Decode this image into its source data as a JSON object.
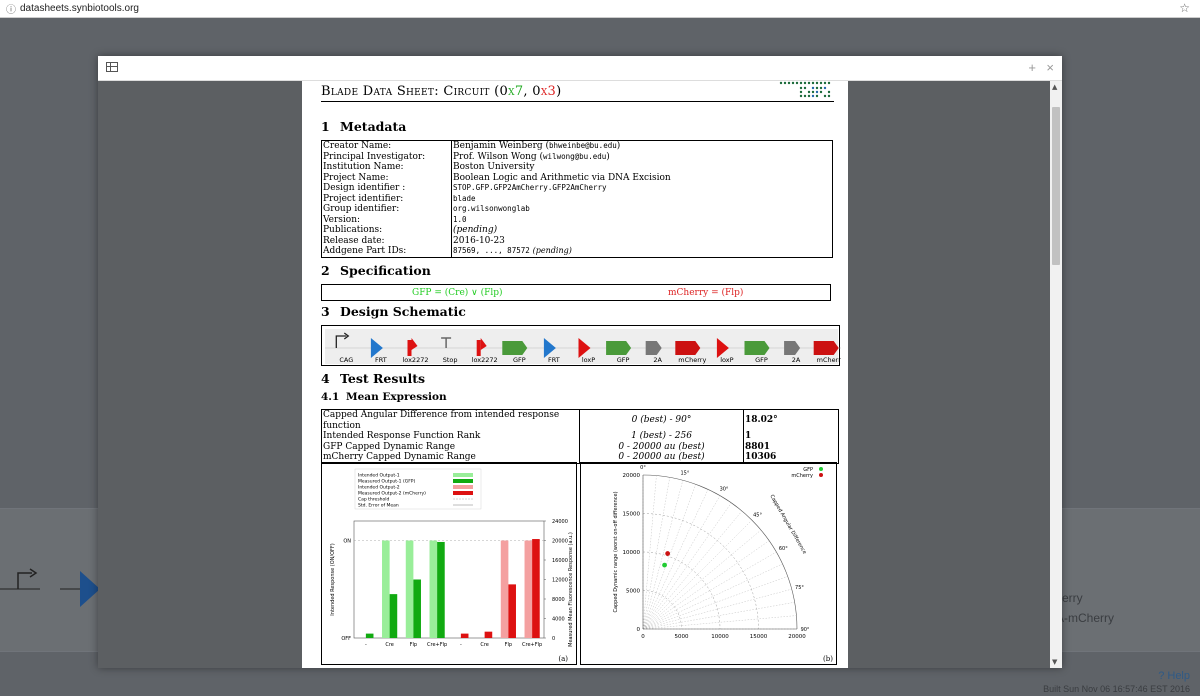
{
  "browser": {
    "url": "datasheets.synbiotools.org",
    "star": "☆"
  },
  "background": {
    "partial_text_1": "erry",
    "partial_text_2": "A-mCherry",
    "help": "Help",
    "footer": "Built Sun Nov 06 16:57:46 EST 2016"
  },
  "modal": {
    "icon": "table-icon",
    "plus": "+",
    "close": "×",
    "scroll_up": "▲",
    "scroll_down": "▼"
  },
  "doc": {
    "title_prefix": "Blade Data Sheet: Circuit (0",
    "title_x1": "x7",
    "title_mid": ", 0",
    "title_x2": "x3",
    "title_suffix": ")",
    "sections": {
      "s1": {
        "num": "1",
        "label": "Metadata"
      },
      "s2": {
        "num": "2",
        "label": "Specification"
      },
      "s3": {
        "num": "3",
        "label": "Design Schematic"
      },
      "s4": {
        "num": "4",
        "label": "Test Results"
      },
      "s41": {
        "num": "4.1",
        "label": "Mean Expression"
      }
    },
    "metadata": {
      "creator_k": "Creator Name:",
      "creator_v": "Benjamin Weinberg (",
      "creator_email": "bhweinbe@bu.edu",
      "creator_close": ")",
      "pi_k": "Principal Investigator:",
      "pi_v": "Prof. Wilson Wong (",
      "pi_email": "wilwong@bu.edu",
      "pi_close": ")",
      "inst_k": "Institution Name:",
      "inst_v": "Boston University",
      "proj_k": "Project Name:",
      "proj_v": "Boolean Logic and Arithmetic via DNA Excision",
      "design_k": "Design identifier :",
      "design_v": "STOP.GFP.GFP2AmCherry.GFP2AmCherry",
      "projid_k": "Project identifier:",
      "projid_v": "blade",
      "group_k": "Group identifier:",
      "group_v": "org.wilsonwonglab",
      "ver_k": "Version:",
      "ver_v": "1.0",
      "pub_k": "Publications:",
      "pub_v": "(pending)",
      "rel_k": "Release date:",
      "rel_v": "2016-10-23",
      "addgene_k": "Addgene Part IDs:",
      "addgene_v": "87569, ..., 87572",
      "addgene_note": "(pending)"
    },
    "spec": {
      "gfp": "GFP = (Cre) ∨ (Flp)",
      "mcherry": "mCherry = (Flp)"
    },
    "schematic": [
      "CAG",
      "FRT",
      "lox2272",
      "Stop",
      "lox2272",
      "GFP",
      "FRT",
      "loxP",
      "GFP",
      "2A",
      "mCherry",
      "loxP",
      "GFP",
      "2A",
      "mCherry"
    ],
    "results": [
      {
        "label": "Capped Angular Difference from intended response function",
        "range": "0 (best) - 90°",
        "value": "18.02°"
      },
      {
        "label": "Intended Response Function Rank",
        "range": "1 (best) - 256",
        "value": "1"
      },
      {
        "label": "GFP Capped Dynamic Range",
        "range": "0 - 20000 au (best)",
        "value": "8801"
      },
      {
        "label": "mCherry Capped Dynamic Range",
        "range": "0 - 20000 au (best)",
        "value": "10306"
      }
    ]
  },
  "colors": {
    "gfp_light": "#99ee99",
    "gfp": "#11aa11",
    "mch_light": "#f4a0a0",
    "mch": "#dd1111",
    "promoter": "#222222",
    "frt": "#2277cc",
    "lox": "#dd1111",
    "cds_green": "#4a9a3a",
    "cds_red": "#cc1111",
    "gray2a": "#777777"
  },
  "chart_data": [
    {
      "type": "bar",
      "panel": "(a)",
      "legend": [
        "Intended Output-1",
        "Measured Output-1 (GFP)",
        "Intended Output-2",
        "Measured Output-2 (mCherry)",
        "Cap threshold",
        "Std. Error of Mean"
      ],
      "ylabel": "Intended Response (ON/OFF)",
      "y2label": "Measured Mean Fluorescence Response (a.u.)",
      "y_ticks_left": [
        "OFF",
        "ON"
      ],
      "y_ticks_right": [
        "0",
        "4000",
        "8000",
        "12000",
        "16000",
        "20000",
        "24000"
      ],
      "ylim": [
        0,
        24000
      ],
      "categories": [
        "-",
        "Cre",
        "Flp",
        "Cre+Flp",
        "-",
        "Cre",
        "Flp",
        "Cre+Flp"
      ],
      "series": [
        {
          "name": "Intended Output-1",
          "values": [
            0,
            20000,
            20000,
            20000,
            null,
            null,
            null,
            null
          ]
        },
        {
          "name": "Measured Output-1 (GFP)",
          "values": [
            900,
            9000,
            12000,
            19700,
            null,
            null,
            null,
            null
          ]
        },
        {
          "name": "Intended Output-2",
          "values": [
            null,
            null,
            null,
            null,
            0,
            0,
            20000,
            20000
          ]
        },
        {
          "name": "Measured Output-2 (mCherry)",
          "values": [
            null,
            null,
            null,
            null,
            900,
            1300,
            11000,
            20300
          ]
        }
      ]
    },
    {
      "type": "scatter",
      "panel": "(b)",
      "ylabel": "Capped Dynamic range (worst on-off difference)",
      "arc_label": "Capped Angular Difference",
      "x_ticks": [
        "0",
        "5000",
        "10000",
        "15000",
        "20000"
      ],
      "y_ticks": [
        "0",
        "5000",
        "10000",
        "15000",
        "20000"
      ],
      "angle_ticks": [
        "0°",
        "15°",
        "30°",
        "45°",
        "60°",
        "75°",
        "90°"
      ],
      "xlim": [
        0,
        20000
      ],
      "ylim": [
        0,
        20000
      ],
      "series": [
        {
          "name": "GFP",
          "points": [
            [
              2800,
              8300
            ]
          ]
        },
        {
          "name": "mCherry",
          "points": [
            [
              3200,
              9800
            ]
          ]
        }
      ]
    }
  ]
}
